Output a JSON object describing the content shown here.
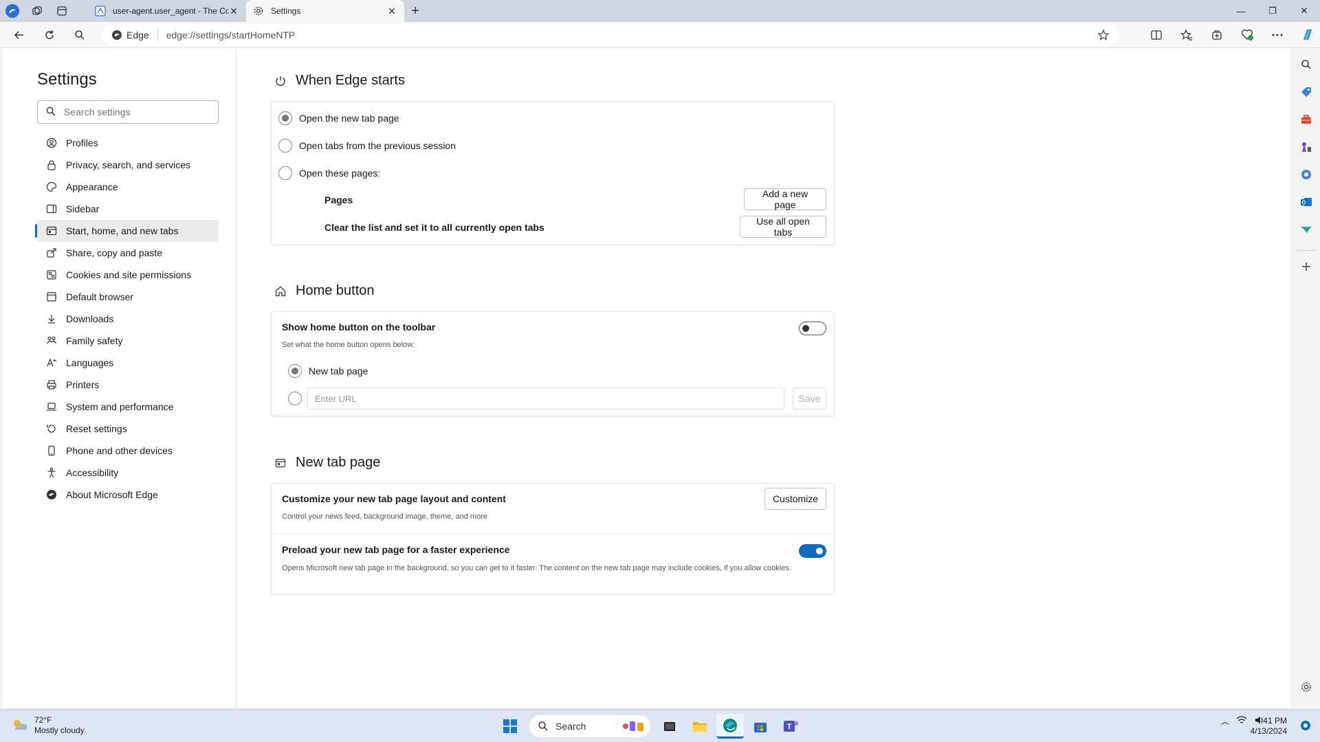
{
  "tabs": [
    {
      "title": "user-agent.user_agent - The Coll",
      "active": false
    },
    {
      "title": "Settings",
      "active": true
    }
  ],
  "address": {
    "chip": "Edge",
    "url": "edge://settings/startHomeNTP"
  },
  "nav": {
    "title": "Settings",
    "search_placeholder": "Search settings",
    "items": [
      {
        "label": "Profiles",
        "icon": "profile-icon"
      },
      {
        "label": "Privacy, search, and services",
        "icon": "lock-icon"
      },
      {
        "label": "Appearance",
        "icon": "palette-icon"
      },
      {
        "label": "Sidebar",
        "icon": "sidebar-icon"
      },
      {
        "label": "Start, home, and new tabs",
        "icon": "home-tabs-icon",
        "selected": true
      },
      {
        "label": "Share, copy and paste",
        "icon": "share-icon"
      },
      {
        "label": "Cookies and site permissions",
        "icon": "cookie-icon"
      },
      {
        "label": "Default browser",
        "icon": "browser-icon"
      },
      {
        "label": "Downloads",
        "icon": "download-icon"
      },
      {
        "label": "Family safety",
        "icon": "family-icon"
      },
      {
        "label": "Languages",
        "icon": "language-icon"
      },
      {
        "label": "Printers",
        "icon": "printer-icon"
      },
      {
        "label": "System and performance",
        "icon": "laptop-icon"
      },
      {
        "label": "Reset settings",
        "icon": "reset-icon"
      },
      {
        "label": "Phone and other devices",
        "icon": "phone-icon"
      },
      {
        "label": "Accessibility",
        "icon": "accessibility-icon"
      },
      {
        "label": "About Microsoft Edge",
        "icon": "edge-logo-icon"
      }
    ]
  },
  "when_edge_starts": {
    "title": "When Edge starts",
    "options": [
      "Open the new tab page",
      "Open tabs from the previous session",
      "Open these pages:"
    ],
    "selected_option": 0,
    "pages_label": "Pages",
    "add_page_button": "Add a new page",
    "clear_label": "Clear the list and set it to all currently open tabs",
    "use_open_tabs_button": "Use all open tabs"
  },
  "home_button": {
    "title": "Home button",
    "show_label": "Show home button on the toolbar",
    "show_toggle": false,
    "desc": "Set what the home button opens below:",
    "option_new_tab": "New tab page",
    "url_placeholder": "Enter URL",
    "save_button": "Save"
  },
  "new_tab_page": {
    "title": "New tab page",
    "customize_label": "Customize your new tab page layout and content",
    "customize_desc": "Control your news feed, background image, theme, and more",
    "customize_button": "Customize",
    "preload_label": "Preload your new tab page for a faster experience",
    "preload_desc": "Opens Microsoft new tab page in the background, so you can get to it faster. The content on the new tab page may include cookies, if you allow cookies.",
    "preload_toggle": true
  },
  "taskbar": {
    "weather_temp": "72°F",
    "weather_desc": "Mostly cloudy",
    "search_label": "Search",
    "time": "4:41 PM",
    "date": "4/13/2024"
  },
  "colors": {
    "accent": "#0f6cbd",
    "tabstrip": "#cfd6e0",
    "taskbar": "#dde6f2"
  }
}
